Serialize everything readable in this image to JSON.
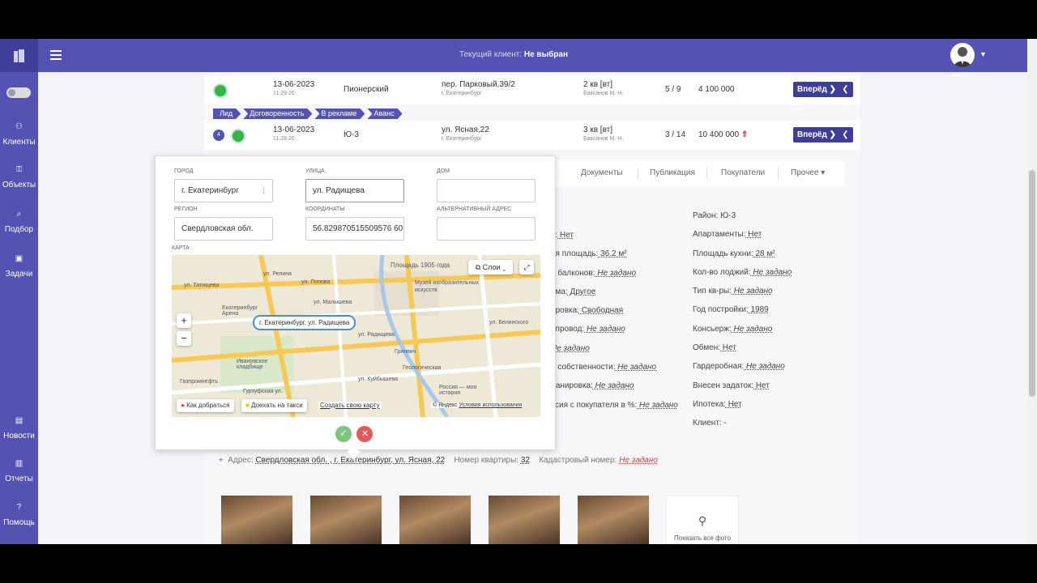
{
  "header": {
    "client_label": "Текущий клиент:",
    "client_value": "Не выбран"
  },
  "sidebar": {
    "items": [
      {
        "label": "Клиенты"
      },
      {
        "label": "Объекты"
      },
      {
        "label": "Подбор"
      },
      {
        "label": "Задачи"
      },
      {
        "label": "Новости"
      },
      {
        "label": "Отчеты"
      },
      {
        "label": "Помощь"
      }
    ]
  },
  "listings": [
    {
      "date": "13-06-2023",
      "time": "11:29:20",
      "rayon": "Пионерский",
      "street": "пер. Парковый,39/2",
      "city": "г. Екатеринбург",
      "rooms": "2 кв [вт]",
      "agent": "Баксанов М. Н.",
      "floor": "5 / 9",
      "price": "4 100 000",
      "next": "Вперёд ❯",
      "back": "❮"
    },
    {
      "date": "13-06-2023",
      "time": "11:28:20",
      "rayon": "Ю-3",
      "street": "ул. Ясная,22",
      "city": "г. Екатеринбург",
      "rooms": "3 кв [вт]",
      "agent": "Баксанов М. Н.",
      "floor": "3 / 14",
      "price": "10 400 000",
      "next": "Вперёд ❯",
      "back": "❮",
      "badge": "4"
    }
  ],
  "stages": [
    "Лид",
    "Договоренность",
    "В рекламе",
    "Аванс"
  ],
  "tabs": [
    "Документы",
    "Публикация",
    "Покупатели",
    "Прочее ▾"
  ],
  "props_mid": [
    [
      "я:",
      " Нет",
      "und"
    ],
    [
      "ая площадь:",
      " 36.2 м²",
      "und"
    ],
    [
      "о балконов:",
      " Не задано",
      "emp"
    ],
    [
      "ома:",
      " Другое",
      "und"
    ],
    [
      "ировка:",
      " Свободная",
      "und"
    ],
    [
      "опровод:",
      " Не задано",
      "emp"
    ],
    [
      "",
      " Не задано",
      "emp"
    ],
    [
      "а собственности:",
      " Не задано",
      "emp"
    ],
    [
      "ланировка:",
      " Не задано",
      "emp"
    ],
    [
      "ссия с покупателя в %:",
      " Не задано",
      "emp"
    ]
  ],
  "props_right": [
    [
      "Район:",
      " Ю-3",
      "plain"
    ],
    [
      "Апартаменты:",
      " Нет",
      "und"
    ],
    [
      "Площадь кухни:",
      " 28 м²",
      "und"
    ],
    [
      "Кол-во лоджий:",
      " Не задано",
      "emp"
    ],
    [
      "Тип кв-ры:",
      " Не задано",
      "emp"
    ],
    [
      "Год постройки:",
      " 1989",
      "und"
    ],
    [
      "Консьерж:",
      " Не задано",
      "emp"
    ],
    [
      "Обмен:",
      " Нет",
      "und"
    ],
    [
      "Гардеробная:",
      " Не задано",
      "emp"
    ],
    [
      "Внесен задаток:",
      " Нет",
      "und"
    ],
    [
      "Ипотека:",
      " Нет",
      "und"
    ],
    [
      "Клиент:",
      " -",
      "plain"
    ]
  ],
  "address": {
    "label": "Адрес:",
    "value": "Свердловская обл. , г. Екатеринбург, ул. Ясная, 22",
    "flat_label": "Номер квартиры:",
    "flat_value": "32",
    "cad_label": "Кадастровый номер:",
    "cad_value": "Не задано"
  },
  "show_all_photos": "Показать все фото",
  "popup": {
    "city_label": "Город",
    "city_value": "г. Екатеринбург",
    "street_label": "Улица",
    "street_value": "ул. Радищева",
    "house_label": "Дом",
    "house_value": "",
    "region_label": "Регион",
    "region_value": "Свердловская обл.",
    "coords_label": "Координаты",
    "coords_value": "56.829870515509576 60.",
    "alt_label": "Альтернативный адрес",
    "alt_value": "",
    "map_label": "Карта",
    "map": {
      "marker": "г. Екатеринбург, ул. Радищева",
      "layers": "Слои",
      "zoom_in": "+",
      "zoom_out": "−",
      "route": "Как добраться",
      "taxi": "Доехать на такси",
      "create": "Создать свою карту",
      "copyright": "© Яндекс",
      "terms": "Условия использования",
      "places": [
        "Площадь 1905 года",
        "Музей изобразительных искусств",
        "Екатеринбург Арена",
        "Ивановское кладбище",
        "Гринвич",
        "Геологическая",
        "Россия — моя история",
        "Газпромнефть",
        "Гурзуфская ул."
      ],
      "streets": [
        "ул. Татищева",
        "ул. Репина",
        "ул. Попова",
        "ул. Малышева",
        "ул. Радищева",
        "ул. Куйбышева",
        "ул. Белинского"
      ]
    }
  }
}
